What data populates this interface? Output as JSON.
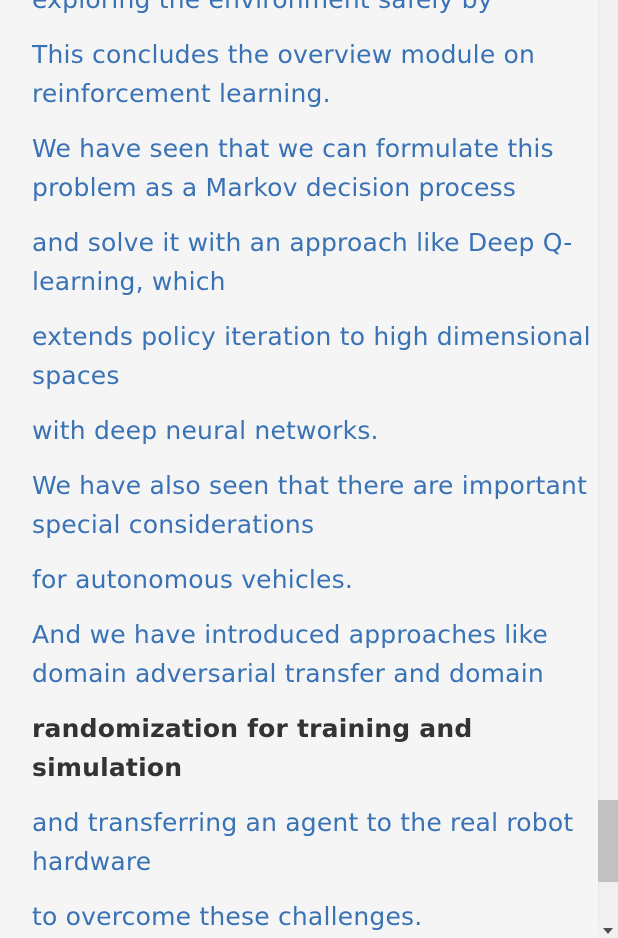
{
  "transcript": {
    "cues": [
      "exploring the environment safely by",
      "This concludes the overview module on reinforcement learning.",
      "We have seen that we can formulate this problem as a Markov decision process",
      "and solve it with an approach like Deep Q-learning, which",
      "extends policy iteration to high dimensional spaces",
      "with deep neural networks.",
      "We have also seen that there are important special considerations",
      "for autonomous vehicles.",
      "And we have introduced approaches like domain adversarial transfer and domain",
      "randomization for training and simulation",
      "and transferring an agent to the real robot hardware",
      "to overcome these challenges."
    ],
    "active_cue_index": 9
  },
  "scrollbar": {
    "position_fraction": 0.88,
    "down_arrow_icon": "chevron-down-icon"
  },
  "colors": {
    "cue_text": "#3a73b5",
    "active_cue_text": "#333333",
    "background": "#f5f5f5"
  }
}
